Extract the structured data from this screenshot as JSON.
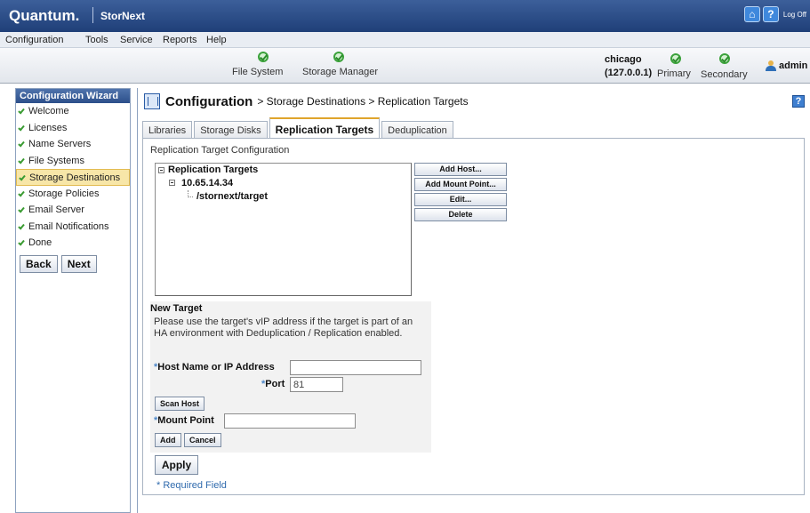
{
  "header": {
    "brand": "Quantum.",
    "product": "StorNext",
    "logoff": "Log Off",
    "home_icon": "home-icon",
    "help_icon": "help-icon",
    "help_glyph": "?"
  },
  "menu": [
    "Configuration",
    "Tools",
    "Service",
    "Reports",
    "Help"
  ],
  "status": {
    "file_system": "File System",
    "storage_manager": "Storage Manager",
    "host_name": "chicago",
    "host_ip": "(127.0.0.1)",
    "primary": "Primary",
    "secondary": "Secondary",
    "user": "admin"
  },
  "wizard": {
    "title": "Configuration Wizard",
    "items": [
      {
        "label": "Welcome",
        "done": true
      },
      {
        "label": "Licenses",
        "done": true
      },
      {
        "label": "Name Servers",
        "done": true
      },
      {
        "label": "File Systems",
        "done": true
      },
      {
        "label": "Storage Destinations",
        "done": true,
        "active": true
      },
      {
        "label": "Storage Policies",
        "done": true
      },
      {
        "label": "Email Server",
        "done": true
      },
      {
        "label": "Email Notifications",
        "done": true
      },
      {
        "label": "Done",
        "done": true
      }
    ],
    "back": "Back",
    "next": "Next"
  },
  "page": {
    "title": "Configuration",
    "breadcrumb": "> Storage Destinations > Replication Targets",
    "help": "?",
    "tabs": [
      {
        "label": "Libraries",
        "active": false
      },
      {
        "label": "Storage Disks",
        "active": false
      },
      {
        "label": "Replication Targets",
        "active": true
      },
      {
        "label": "Deduplication",
        "active": false
      }
    ],
    "section_label": "Replication Target Configuration",
    "tree": {
      "root": "Replication Targets",
      "host": "10.65.14.34",
      "path": "/stornext/target"
    },
    "actions": {
      "add_host": "Add Host...",
      "add_mount": "Add Mount Point...",
      "edit": "Edit...",
      "delete": "Delete"
    },
    "new_target": {
      "title": "New Target",
      "description": "Please use the target's vIP address if the target is part of an HA environment with Deduplication / Replication enabled.",
      "required_mark": "*",
      "host_label": "Host Name or IP Address",
      "host_value": "",
      "port_label": "Port",
      "port_value": "81",
      "scan_host": "Scan Host",
      "mount_label": "Mount Point",
      "mount_value": "",
      "add": "Add",
      "cancel": "Cancel"
    },
    "apply": "Apply",
    "required_note": "* Required Field"
  },
  "colors": {
    "header": "#2a4a84",
    "active_wizard": "#f7e6a8",
    "ok_green": "#3ba23b",
    "link_blue": "#2f6aad"
  }
}
